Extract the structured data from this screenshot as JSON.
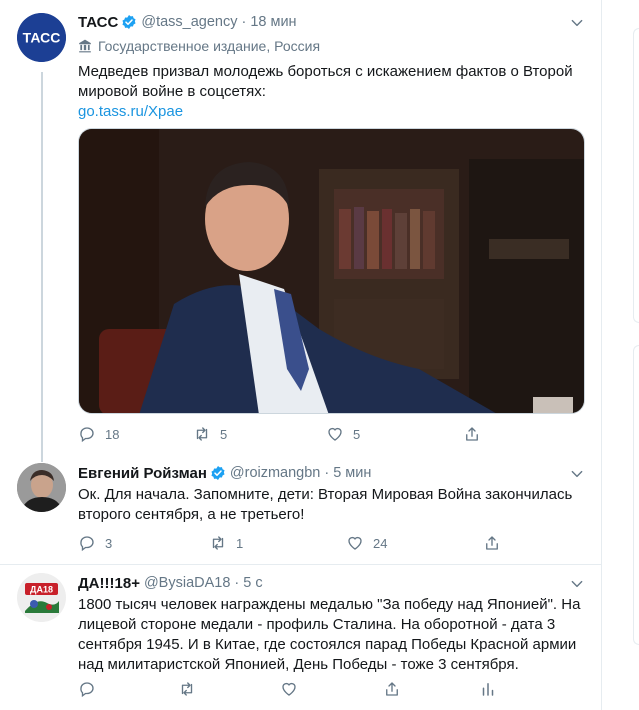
{
  "tweets": [
    {
      "name": "ТАСС",
      "handle": "@tass_agency",
      "dot": "·",
      "time": "18 мин",
      "label": "Государственное издание, Россия",
      "text": "Медведев призвал молодежь бороться с искажением фактов о Второй мировой войне в соцсетях:",
      "link": "go.tass.ru/Храе",
      "avatar_text": "ТАСС",
      "actions": {
        "reply": "18",
        "retweet": "5",
        "like": "5"
      }
    },
    {
      "name": "Евгений Ройзман",
      "handle": "@roizmangbn",
      "dot": "·",
      "time": "5 мин",
      "text": "Ок. Для начала. Запомните, дети: Вторая Мировая Война закончилась второго сентября, а не третьего!",
      "actions": {
        "reply": "3",
        "retweet": "1",
        "like": "24"
      }
    },
    {
      "name": "ДА!!!18+",
      "handle": "@BysiaDA18",
      "dot": "·",
      "time": "5 с",
      "text": "1800 тысяч человек награждены медалью \"За победу над Японией\". На лицевой стороне медали - профиль Сталина. На оборотной - дата 3 сентября 1945. И в Китае, где состоялся парад Победы Красной армии над милитаристской Японией, День Победы - тоже 3 сентября.",
      "avatar_text": "ДА18"
    }
  ],
  "icons": {
    "verified": "verified-badge-icon",
    "caret": "chevron-down-icon",
    "government": "government-building-icon",
    "reply": "reply-icon",
    "retweet": "retweet-icon",
    "like": "heart-icon",
    "share": "share-icon",
    "analytics": "analytics-icon"
  },
  "colors": {
    "accent": "#1da1f2",
    "link": "#1b95e0",
    "secondary_text": "#657786",
    "tass_blue": "#1c3f94",
    "border": "#e6ecf0"
  }
}
